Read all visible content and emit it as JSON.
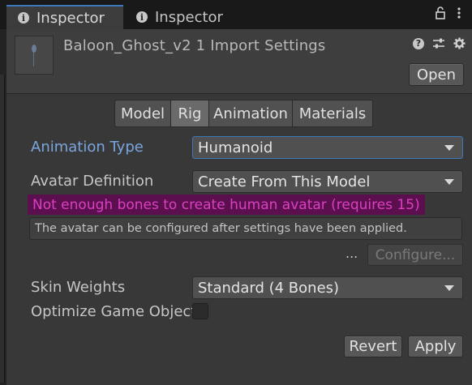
{
  "tabs": {
    "active_label": "Inspector",
    "inactive_label": "Inspector"
  },
  "header": {
    "title": "Baloon_Ghost_v2 1 Import Settings",
    "open_label": "Open"
  },
  "subtabs": [
    "Model",
    "Rig",
    "Animation",
    "Materials"
  ],
  "selected_subtab": "Rig",
  "fields": {
    "animation_type_label": "Animation Type",
    "animation_type_value": "Humanoid",
    "avatar_definition_label": "Avatar Definition",
    "avatar_definition_value": "Create From This Model",
    "error_text": "Not enough bones to create human avatar (requires 15)",
    "help_text": "The avatar can be configured after settings have been applied.",
    "dots": "...",
    "configure_label": "Configure...",
    "skin_weights_label": "Skin Weights",
    "skin_weights_value": "Standard (4 Bones)",
    "optimize_label": "Optimize Game Object",
    "optimize_checked": false
  },
  "footer": {
    "revert_label": "Revert",
    "apply_label": "Apply"
  },
  "colors": {
    "accent": "#3a79bb",
    "label_blue": "#7aa6df",
    "error_text": "#d940c0",
    "error_bg": "#5c0f4e"
  },
  "icons": [
    "info-icon",
    "lock-icon",
    "more-icon",
    "help-icon",
    "preset-icon",
    "gear-icon"
  ]
}
